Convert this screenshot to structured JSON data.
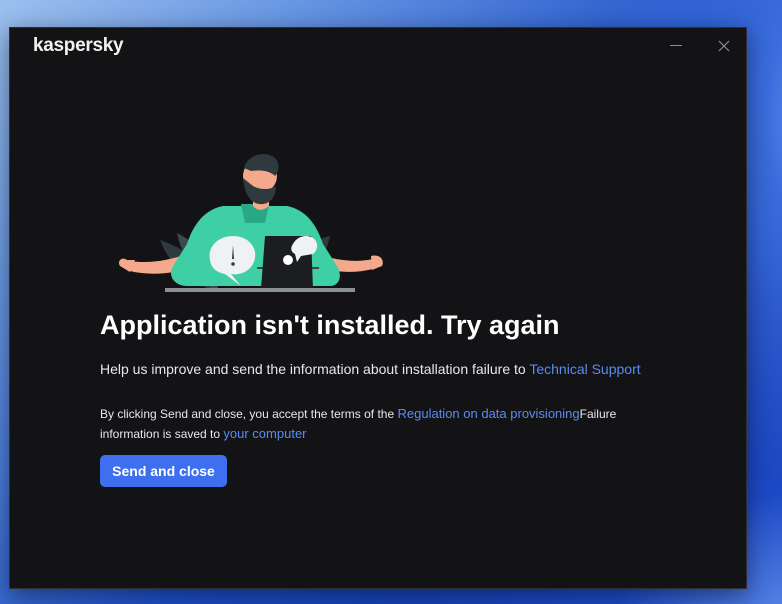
{
  "window": {
    "brand": "kaspersky",
    "minimize_icon": "minimize-icon",
    "close_icon": "close-icon"
  },
  "main": {
    "title": "Application isn't installed. Try again",
    "help_text": "Help us improve and send the information about installation failure to ",
    "help_link": "Technical Support",
    "terms_prefix": "By clicking Send and close, you accept the terms of the ",
    "terms_link": "Regulation on data provisioning",
    "terms_suffix": "Failure information is saved to ",
    "location_link": "your computer",
    "send_button": "Send and close"
  },
  "colors": {
    "window_bg": "#131316",
    "accent": "#3d6ff0",
    "link": "#5b8bf0",
    "illustration_green": "#3fcfa4"
  }
}
